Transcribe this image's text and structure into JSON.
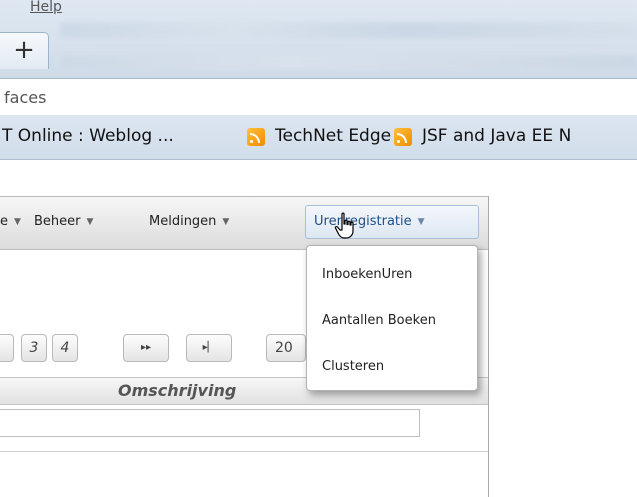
{
  "browser": {
    "menu": {
      "help_label": "Help"
    },
    "new_tab_label": "+",
    "address_fragment": "faces",
    "bookmarks": [
      {
        "label": "T Online : Weblog ...",
        "icon": "none"
      },
      {
        "label": "TechNet Edge",
        "icon": "rss-feed-icon"
      },
      {
        "label": "JSF and Java EE N",
        "icon": "rss-feed-icon"
      }
    ]
  },
  "app": {
    "menubar": {
      "items": [
        {
          "label": "e"
        },
        {
          "label": "Beheer"
        },
        {
          "label": "Meldingen"
        }
      ],
      "active": {
        "label": "Urenregistratie"
      }
    },
    "dropdown": {
      "items": [
        {
          "label": "InboekenUren"
        },
        {
          "label": "Aantallen Boeken"
        },
        {
          "label": "Clusteren"
        }
      ]
    },
    "pager": {
      "pages": [
        "",
        "3",
        "4"
      ],
      "next_label": "▸▸",
      "last_label": "▸▏",
      "rows_per_page": "20"
    },
    "table": {
      "columns": [
        {
          "label": "Omschrijving"
        }
      ]
    }
  },
  "colors": {
    "accent": "#1f4f86",
    "rss": "#f08a00"
  }
}
